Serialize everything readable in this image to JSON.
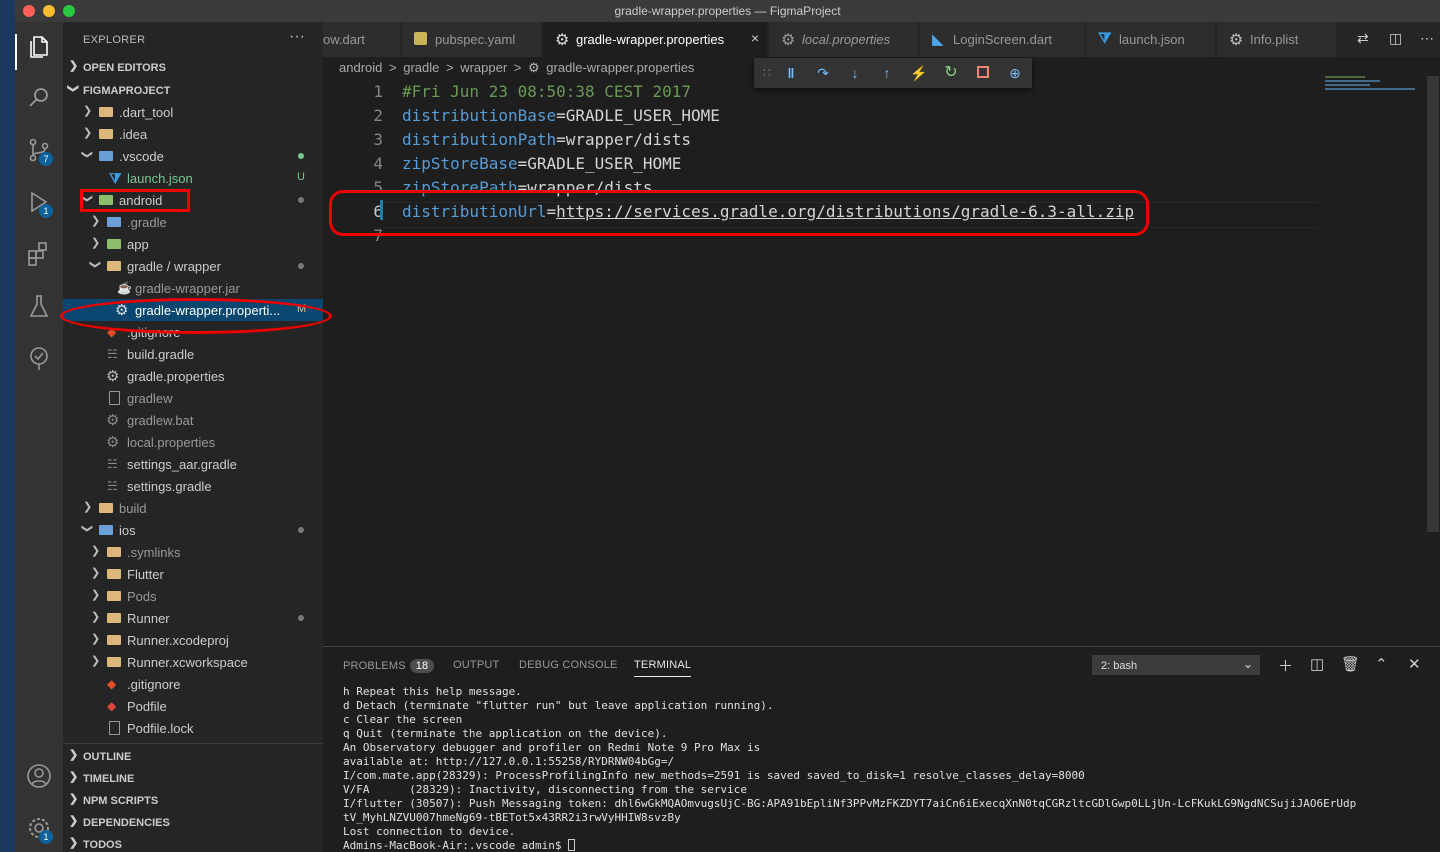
{
  "window": {
    "title": "gradle-wrapper.properties — FigmaProject"
  },
  "activity": {
    "scm_badge": "7",
    "debug_badge": "1",
    "settings_badge": "1"
  },
  "sidebar": {
    "header": "EXPLORER",
    "more": "···",
    "open_editors": "OPEN EDITORS",
    "project": "FIGMAPROJECT",
    "items": [
      {
        "label": ".dart_tool"
      },
      {
        "label": ".idea"
      },
      {
        "label": ".vscode"
      },
      {
        "label": "launch.json",
        "status": "U"
      },
      {
        "label": "android"
      },
      {
        "label": ".gradle"
      },
      {
        "label": "app"
      },
      {
        "label": "gradle / wrapper"
      },
      {
        "label": "gradle-wrapper.jar"
      },
      {
        "label": "gradle-wrapper.properti...",
        "status": "M"
      },
      {
        "label": ".gitignore"
      },
      {
        "label": "build.gradle"
      },
      {
        "label": "gradle.properties"
      },
      {
        "label": "gradlew"
      },
      {
        "label": "gradlew.bat"
      },
      {
        "label": "local.properties"
      },
      {
        "label": "settings_aar.gradle"
      },
      {
        "label": "settings.gradle"
      },
      {
        "label": "build"
      },
      {
        "label": "ios"
      },
      {
        "label": ".symlinks"
      },
      {
        "label": "Flutter"
      },
      {
        "label": "Pods"
      },
      {
        "label": "Runner"
      },
      {
        "label": "Runner.xcodeproj"
      },
      {
        "label": "Runner.xcworkspace"
      },
      {
        "label": ".gitignore"
      },
      {
        "label": "Podfile"
      },
      {
        "label": "Podfile.lock"
      }
    ],
    "bottom_sections": [
      "OUTLINE",
      "TIMELINE",
      "NPM SCRIPTS",
      "DEPENDENCIES",
      "TODOS"
    ]
  },
  "tabs": [
    {
      "label": "ow.dart"
    },
    {
      "label": "pubspec.yaml"
    },
    {
      "label": "gradle-wrapper.properties",
      "close": "×"
    },
    {
      "label": "local.properties"
    },
    {
      "label": "LoginScreen.dart"
    },
    {
      "label": "launch.json"
    },
    {
      "label": "Info.plist"
    }
  ],
  "breadcrumb": [
    "android",
    ">",
    "gradle",
    ">",
    "wrapper",
    ">",
    "gradle-wrapper.properties"
  ],
  "editor": {
    "lines": [
      {
        "n": "1",
        "comment": "#Fri Jun 23 08:50:38 CEST 2017"
      },
      {
        "n": "2",
        "key": "distributionBase",
        "eq": "=",
        "value": "GRADLE_USER_HOME"
      },
      {
        "n": "3",
        "key": "distributionPath",
        "eq": "=",
        "value": "wrapper/dists"
      },
      {
        "n": "4",
        "key": "zipStoreBase",
        "eq": "=",
        "value": "GRADLE_USER_HOME"
      },
      {
        "n": "5",
        "key": "zipStorePath",
        "eq": "=",
        "value": "wrapper/dists"
      },
      {
        "n": "6",
        "key": "distributionUrl",
        "eq": "=",
        "value": "https://services.gradle.org/distributions/gradle-6.3-all.zip"
      },
      {
        "n": "7"
      }
    ]
  },
  "panel": {
    "tabs": [
      "PROBLEMS",
      "OUTPUT",
      "DEBUG CONSOLE",
      "TERMINAL"
    ],
    "problems_count": "18",
    "terminal_select": "2: bash",
    "terminal_lines": [
      "h Repeat this help message.",
      "d Detach (terminate \"flutter run\" but leave application running).",
      "c Clear the screen",
      "q Quit (terminate the application on the device).",
      "An Observatory debugger and profiler on Redmi Note 9 Pro Max is",
      "available at: http://127.0.0.1:55258/RYDRNW04bGg=/",
      "I/com.mate.app(28329): ProcessProfilingInfo new_methods=2591 is saved saved_to_disk=1 resolve_classes_delay=8000",
      "V/FA      (28329): Inactivity, disconnecting from the service",
      "I/flutter (30507): Push Messaging token: dhl6wGkMQAOmvugsUjC-BG:APA91bEpliNf3PPvMzFKZDYT7aiCn6iExecqXnN0tqCGRzltcGDlGwp0LLjUn-LcFKukLG9NgdNCSujiJAO6ErUdp",
      "tV_MyhLNZVU007hmeNg69-tBETot5x43RR2i3rwVyHHIW8svzBy",
      "Lost connection to device."
    ],
    "prompt": "Admins-MacBook-Air:.vscode admin$ "
  },
  "colors": {
    "accent": "#0e639c",
    "annotation": "#e00000",
    "selection": "#094771"
  }
}
